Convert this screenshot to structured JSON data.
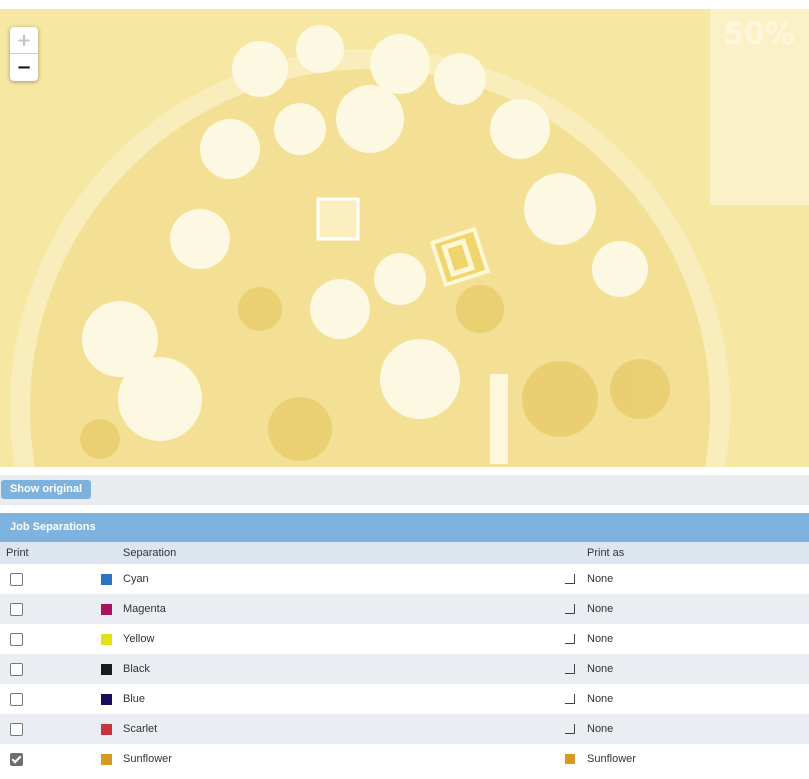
{
  "preview": {
    "zoom_in_label": "+",
    "zoom_out_label": "−",
    "zoom_level": "50%"
  },
  "toolbar": {
    "show_original_label": "Show original"
  },
  "panel": {
    "title": "Job Separations",
    "columns": {
      "print": "Print",
      "separation": "Separation",
      "print_as": "Print as"
    },
    "rows": [
      {
        "checked": false,
        "name": "Cyan",
        "color": "#2b73c9",
        "print_as": "None"
      },
      {
        "checked": false,
        "name": "Magenta",
        "color": "#a8145f",
        "print_as": "None"
      },
      {
        "checked": false,
        "name": "Yellow",
        "color": "#e5df16",
        "print_as": "None"
      },
      {
        "checked": false,
        "name": "Black",
        "color": "#1a1a1a",
        "print_as": "None"
      },
      {
        "checked": false,
        "name": "Blue",
        "color": "#1b0c5a",
        "print_as": "None"
      },
      {
        "checked": false,
        "name": "Scarlet",
        "color": "#c8343b",
        "print_as": "None"
      },
      {
        "checked": true,
        "name": "Sunflower",
        "color": "#d8991f",
        "print_as": "Sunflower",
        "print_as_color": "#d8991f"
      }
    ]
  }
}
